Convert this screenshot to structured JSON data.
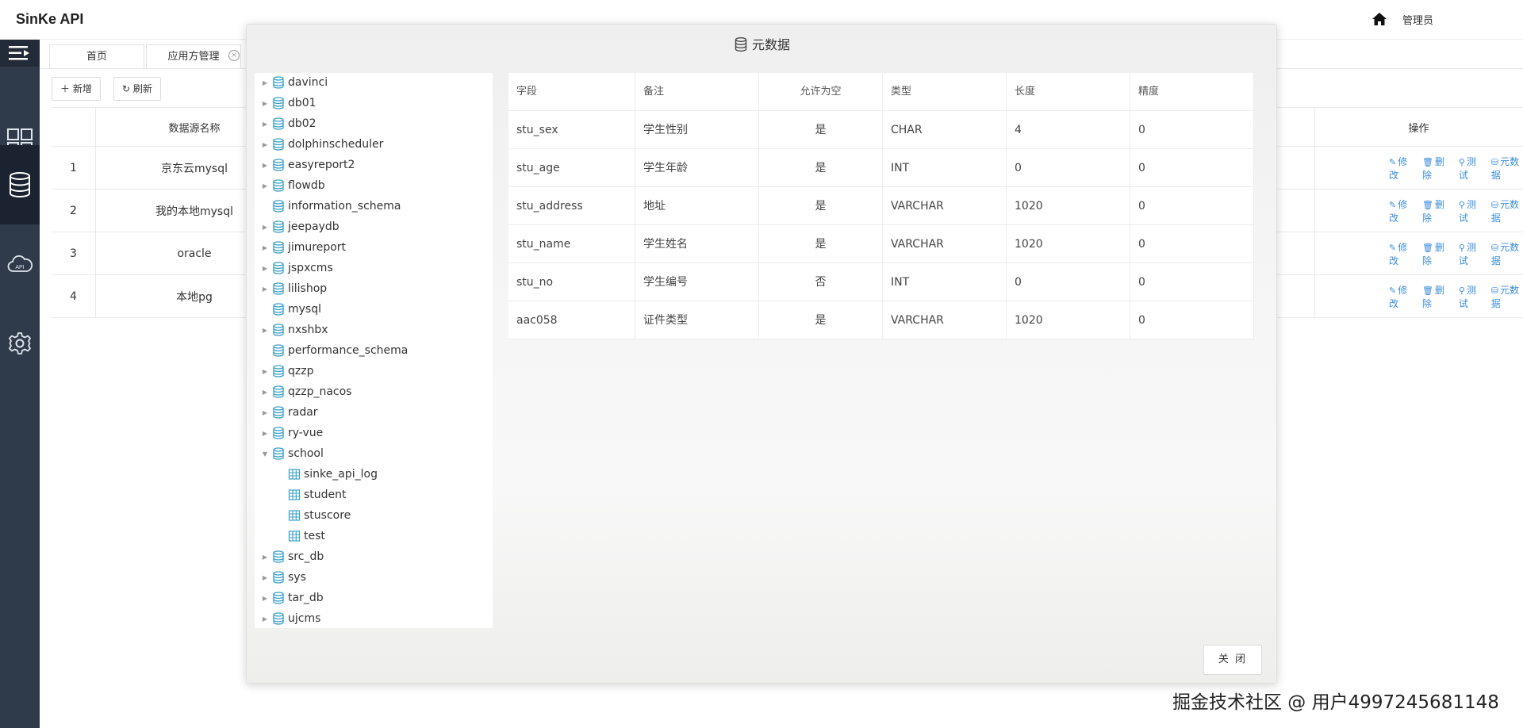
{
  "header": {
    "app_title": "SinKe API",
    "user_label": "管理员",
    "home_icon": "home-icon"
  },
  "sidebar": {
    "items": [
      {
        "icon": "dashboard-grid-icon"
      },
      {
        "icon": "database-icon"
      },
      {
        "icon": "api-cloud-icon",
        "label": "API"
      },
      {
        "icon": "gear-icon"
      }
    ]
  },
  "tabs": [
    {
      "label": "首页"
    },
    {
      "label": "应用方管理"
    }
  ],
  "toolbar": {
    "add_label": "新增",
    "refresh_label": "刷新"
  },
  "datasource_table": {
    "col_name": "数据源名称",
    "col_ops": "操作",
    "rows": [
      {
        "index": "1",
        "name": "京东云mysql"
      },
      {
        "index": "2",
        "name": "我的本地mysql"
      },
      {
        "index": "3",
        "name": "oracle"
      },
      {
        "index": "4",
        "name": "本地pg"
      }
    ],
    "ops": {
      "edit": "修改",
      "delete": "删除",
      "test": "测试",
      "meta": "元数据"
    }
  },
  "modal": {
    "title": "元数据",
    "close_label": "关 闭",
    "tree": [
      {
        "label": "davinci",
        "type": "db",
        "expandable": true
      },
      {
        "label": "db01",
        "type": "db",
        "expandable": true
      },
      {
        "label": "db02",
        "type": "db",
        "expandable": true
      },
      {
        "label": "dolphinscheduler",
        "type": "db",
        "expandable": true
      },
      {
        "label": "easyreport2",
        "type": "db",
        "expandable": true
      },
      {
        "label": "flowdb",
        "type": "db",
        "expandable": true
      },
      {
        "label": "information_schema",
        "type": "db",
        "expandable": false
      },
      {
        "label": "jeepaydb",
        "type": "db",
        "expandable": true
      },
      {
        "label": "jimureport",
        "type": "db",
        "expandable": true
      },
      {
        "label": "jspxcms",
        "type": "db",
        "expandable": true
      },
      {
        "label": "lilishop",
        "type": "db",
        "expandable": true
      },
      {
        "label": "mysql",
        "type": "db",
        "expandable": false
      },
      {
        "label": "nxshbx",
        "type": "db",
        "expandable": true
      },
      {
        "label": "performance_schema",
        "type": "db",
        "expandable": false
      },
      {
        "label": "qzzp",
        "type": "db",
        "expandable": true
      },
      {
        "label": "qzzp_nacos",
        "type": "db",
        "expandable": true
      },
      {
        "label": "radar",
        "type": "db",
        "expandable": true
      },
      {
        "label": "ry-vue",
        "type": "db",
        "expandable": true
      },
      {
        "label": "school",
        "type": "db",
        "expandable": true,
        "expanded": true
      },
      {
        "label": "sinke_api_log",
        "type": "table",
        "expandable": false
      },
      {
        "label": "student",
        "type": "table",
        "expandable": false
      },
      {
        "label": "stuscore",
        "type": "table",
        "expandable": false
      },
      {
        "label": "test",
        "type": "table",
        "expandable": false
      },
      {
        "label": "src_db",
        "type": "db",
        "expandable": true
      },
      {
        "label": "sys",
        "type": "db",
        "expandable": true
      },
      {
        "label": "tar_db",
        "type": "db",
        "expandable": true
      },
      {
        "label": "ujcms",
        "type": "db",
        "expandable": true
      }
    ],
    "columns": {
      "field": "字段",
      "remark": "备注",
      "nullable": "允许为空",
      "type": "类型",
      "length": "长度",
      "precision": "精度"
    },
    "rows": [
      {
        "field": "stu_sex",
        "remark": "学生性别",
        "nullable": "是",
        "type": "CHAR",
        "length": "4",
        "precision": "0"
      },
      {
        "field": "stu_age",
        "remark": "学生年龄",
        "nullable": "是",
        "type": "INT",
        "length": "0",
        "precision": "0"
      },
      {
        "field": "stu_address",
        "remark": "地址",
        "nullable": "是",
        "type": "VARCHAR",
        "length": "1020",
        "precision": "0"
      },
      {
        "field": "stu_name",
        "remark": "学生姓名",
        "nullable": "是",
        "type": "VARCHAR",
        "length": "1020",
        "precision": "0"
      },
      {
        "field": "stu_no",
        "remark": "学生编号",
        "nullable": "否",
        "type": "INT",
        "length": "0",
        "precision": "0"
      },
      {
        "field": "aac058",
        "remark": "证件类型",
        "nullable": "是",
        "type": "VARCHAR",
        "length": "1020",
        "precision": "0"
      }
    ]
  },
  "watermark": "掘金技术社区 @ 用户4997245681148",
  "colors": {
    "sidebar_bg": "#2f3a4b",
    "link": "#3c8dde",
    "db_icon": "#3aa0c8"
  }
}
